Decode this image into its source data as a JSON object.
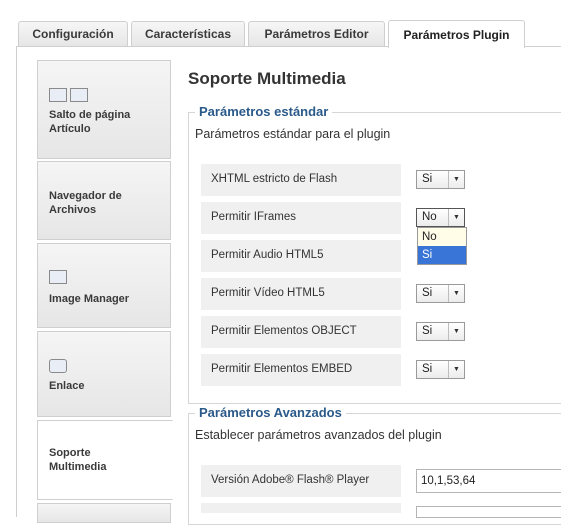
{
  "tabs": [
    {
      "label": "Configuración"
    },
    {
      "label": "Características"
    },
    {
      "label": "Parámetros Editor"
    },
    {
      "label": "Parámetros Plugin",
      "active": true
    }
  ],
  "nav": [
    {
      "label": "Salto de página Artículo",
      "icon": "page-break-icon"
    },
    {
      "label": "Navegador de Archivos"
    },
    {
      "label": "Image Manager",
      "icon": "image-icon"
    },
    {
      "label": "Enlace",
      "icon": "link-icon"
    },
    {
      "label": "Soporte Multimedia",
      "active": true
    }
  ],
  "title": "Soporte Multimedia",
  "standard": {
    "legend": "Parámetros estándar",
    "desc": "Parámetros estándar para el plugin",
    "rows": [
      {
        "label": "XHTML estricto de Flash",
        "value": "Si"
      },
      {
        "label": "Permitir IFrames",
        "value": "No"
      },
      {
        "label": "Permitir Audio HTML5",
        "value": ""
      },
      {
        "label": "Permitir Vídeo HTML5",
        "value": "Si"
      },
      {
        "label": "Permitir Elementos OBJECT",
        "value": "Si"
      },
      {
        "label": "Permitir Elementos EMBED",
        "value": "Si"
      }
    ],
    "dropdown": {
      "options": [
        "No",
        "Si"
      ],
      "highlighted": "Si"
    }
  },
  "advanced": {
    "legend": "Parámetros Avanzados",
    "desc": "Establecer parámetros avanzados del plugin",
    "flash_label": "Versión Adobe® Flash® Player",
    "flash_value": "10,1,53,64"
  },
  "colors": {
    "legend": "#2a5a8a",
    "highlight": "#3875d7",
    "dropdown_bg": "#fffce8"
  }
}
